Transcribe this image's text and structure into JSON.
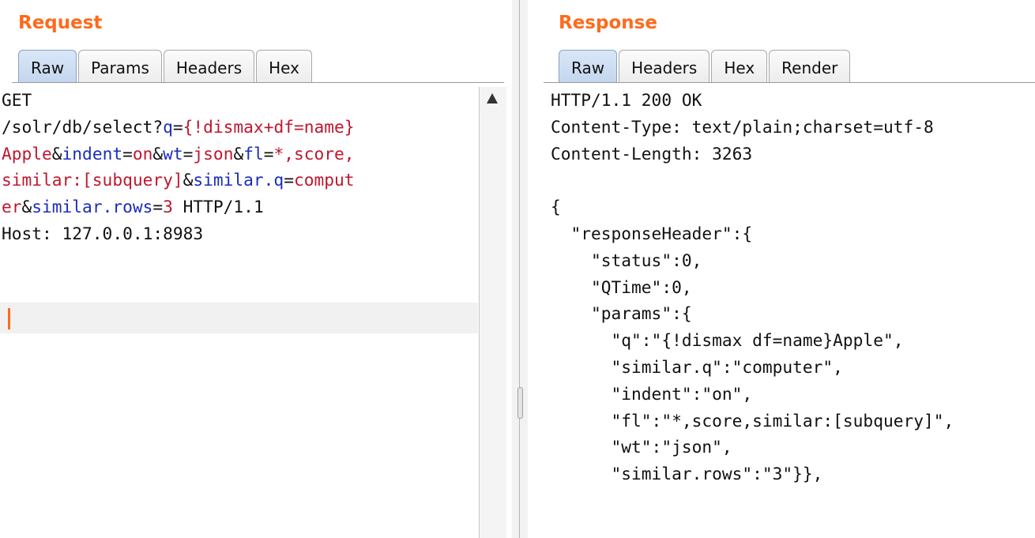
{
  "request": {
    "title": "Request",
    "tabs": [
      "Raw",
      "Params",
      "Headers",
      "Hex"
    ],
    "active_tab": "Raw",
    "lines": [
      [
        {
          "t": "GET",
          "c": "p"
        }
      ],
      [
        {
          "t": "/solr/db/select?",
          "c": "p"
        },
        {
          "t": "q",
          "c": "k"
        },
        {
          "t": "=",
          "c": "p"
        },
        {
          "t": "{!dismax+df=name}",
          "c": "v"
        }
      ],
      [
        {
          "t": "Apple",
          "c": "v"
        },
        {
          "t": "&",
          "c": "p"
        },
        {
          "t": "indent",
          "c": "k"
        },
        {
          "t": "=",
          "c": "p"
        },
        {
          "t": "on",
          "c": "v"
        },
        {
          "t": "&",
          "c": "p"
        },
        {
          "t": "wt",
          "c": "k"
        },
        {
          "t": "=",
          "c": "p"
        },
        {
          "t": "json",
          "c": "v"
        },
        {
          "t": "&",
          "c": "p"
        },
        {
          "t": "fl",
          "c": "k"
        },
        {
          "t": "=",
          "c": "p"
        },
        {
          "t": "*,score,",
          "c": "v"
        }
      ],
      [
        {
          "t": "similar:[subquery]",
          "c": "v"
        },
        {
          "t": "&",
          "c": "p"
        },
        {
          "t": "similar.q",
          "c": "k"
        },
        {
          "t": "=",
          "c": "p"
        },
        {
          "t": "comput",
          "c": "v"
        }
      ],
      [
        {
          "t": "er",
          "c": "v"
        },
        {
          "t": "&",
          "c": "p"
        },
        {
          "t": "similar.rows",
          "c": "k"
        },
        {
          "t": "=",
          "c": "p"
        },
        {
          "t": "3",
          "c": "v"
        },
        {
          "t": " HTTP/1.1",
          "c": "p"
        }
      ],
      [
        {
          "t": "Host: 127.0.0.1:8983",
          "c": "p"
        }
      ]
    ]
  },
  "response": {
    "title": "Response",
    "tabs": [
      "Raw",
      "Headers",
      "Hex",
      "Render"
    ],
    "active_tab": "Raw",
    "lines": [
      "HTTP/1.1 200 OK",
      "Content-Type: text/plain;charset=utf-8",
      "Content-Length: 3263",
      "",
      "{",
      "  \"responseHeader\":{",
      "    \"status\":0,",
      "    \"QTime\":0,",
      "    \"params\":{",
      "      \"q\":\"{!dismax df=name}Apple\",",
      "      \"similar.q\":\"computer\",",
      "      \"indent\":\"on\",",
      "      \"fl\":\"*,score,similar:[subquery]\",",
      "      \"wt\":\"json\",",
      "      \"similar.rows\":\"3\"}},"
    ]
  },
  "colors": {
    "accent": "#ff6a1c",
    "param_name": "#1a2dbd",
    "param_value": "#c0172e"
  }
}
